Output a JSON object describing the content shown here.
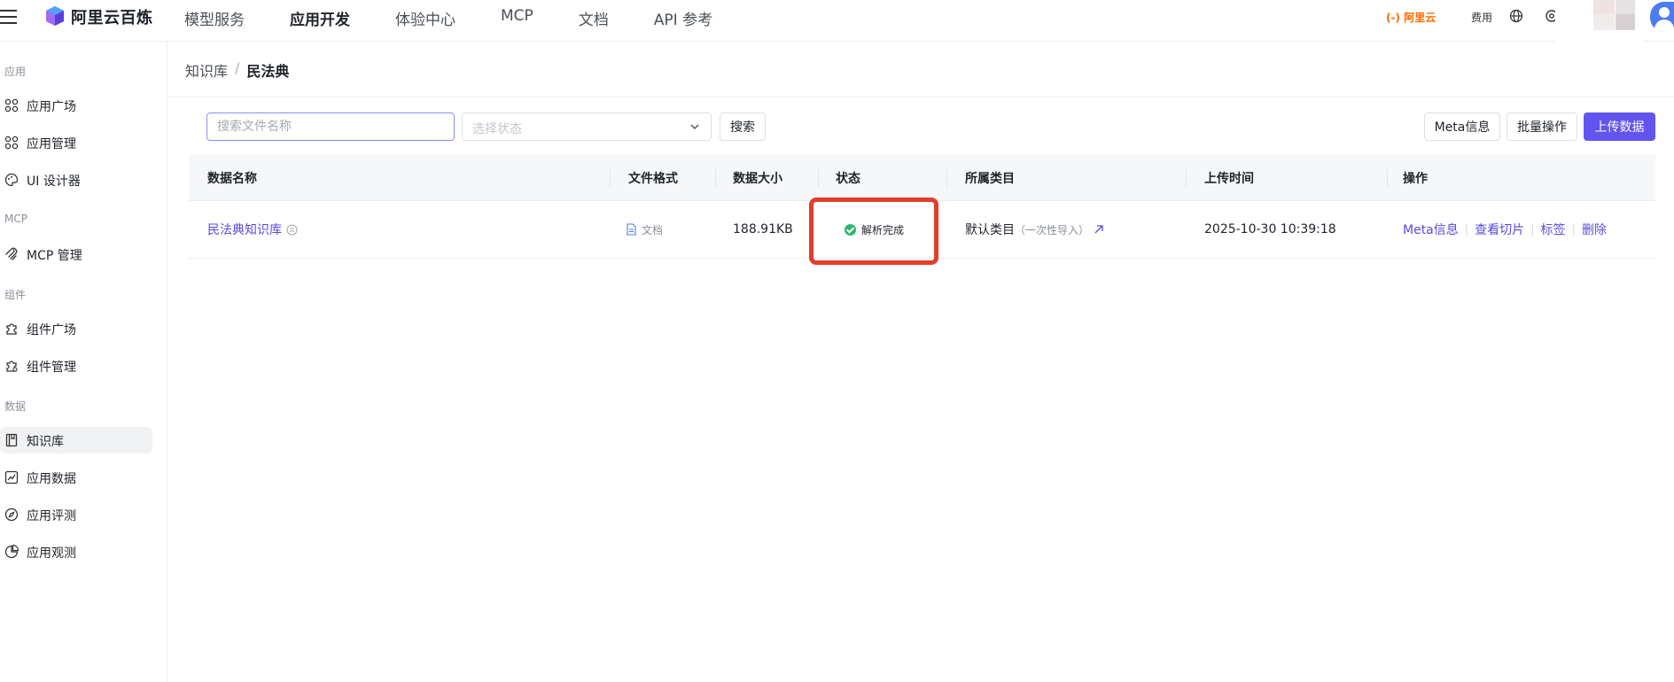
{
  "topbar": {
    "brand": "阿里云百炼",
    "nav": [
      "模型服务",
      "应用开发",
      "体验中心",
      "MCP",
      "文档",
      "API 参考"
    ],
    "active_nav": "应用开发",
    "aliyun_logo": "(-) 阿里云",
    "fee": "费用"
  },
  "sidebar": {
    "groups": [
      {
        "title": "应用",
        "items": [
          "应用广场",
          "应用管理",
          "UI 设计器"
        ]
      },
      {
        "title": "MCP",
        "items": [
          "MCP 管理"
        ]
      },
      {
        "title": "组件",
        "items": [
          "组件广场",
          "组件管理"
        ]
      },
      {
        "title": "数据",
        "items": [
          "知识库",
          "应用数据",
          "应用评测",
          "应用观测"
        ]
      }
    ],
    "active_item": "知识库"
  },
  "breadcrumb": {
    "parent": "知识库",
    "separator": "/",
    "current": "民法典"
  },
  "toolbar": {
    "search_placeholder": "搜索文件名称",
    "status_placeholder": "选择状态",
    "search_button": "搜索",
    "meta_button": "Meta信息",
    "batch_button": "批量操作",
    "upload_button": "上传数据"
  },
  "table": {
    "headers": [
      "数据名称",
      "文件格式",
      "数据大小",
      "状态",
      "所属类目",
      "上传时间",
      "操作"
    ],
    "rows": [
      {
        "name": "民法典知识库",
        "format": "文档",
        "size": "188.91KB",
        "status": "解析完成",
        "category": "默认类目",
        "category_note": "（一次性导入）",
        "upload_time": "2025-10-30 10:39:18",
        "actions": [
          "Meta信息",
          "查看切片",
          "标签",
          "删除"
        ]
      }
    ]
  },
  "colors": {
    "accent": "#6254ee",
    "link": "#5b4bdb",
    "success": "#2bb673",
    "highlight": "#e23e2c",
    "brand_orange": "#ff6a00"
  }
}
